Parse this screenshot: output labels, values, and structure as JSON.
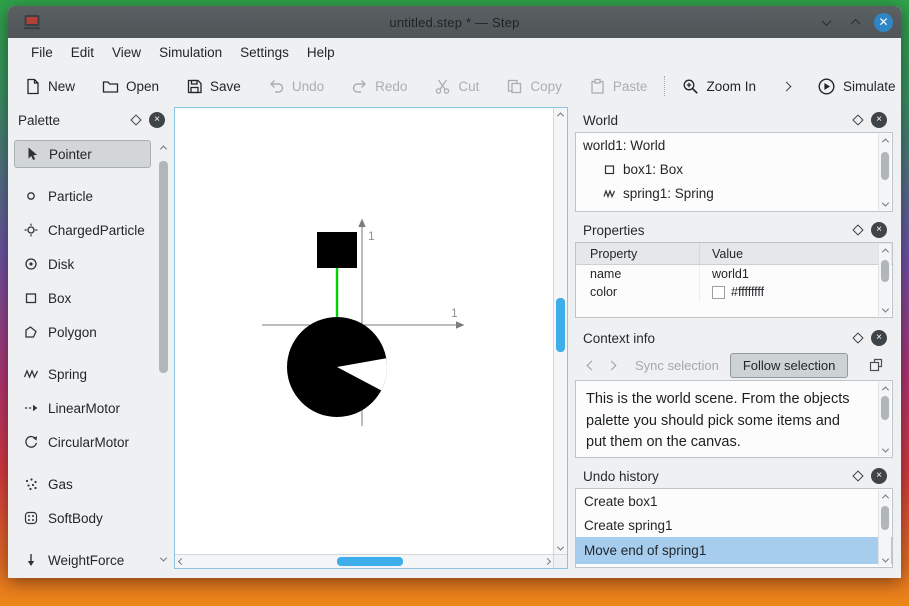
{
  "window": {
    "title": "untitled.step * — Step"
  },
  "menubar": {
    "items": [
      "File",
      "Edit",
      "View",
      "Simulation",
      "Settings",
      "Help"
    ]
  },
  "toolbar": {
    "new": "New",
    "open": "Open",
    "save": "Save",
    "undo": "Undo",
    "redo": "Redo",
    "cut": "Cut",
    "copy": "Copy",
    "paste": "Paste",
    "zoom_in": "Zoom In",
    "simulate": "Simulate"
  },
  "palette": {
    "title": "Palette",
    "items": [
      {
        "label": "Pointer",
        "icon": "pointer-icon",
        "selected": true
      },
      {
        "label": "Particle",
        "icon": "particle-icon",
        "selected": false
      },
      {
        "label": "ChargedParticle",
        "icon": "charged-particle-icon",
        "selected": false
      },
      {
        "label": "Disk",
        "icon": "disk-icon",
        "selected": false
      },
      {
        "label": "Box",
        "icon": "box-icon",
        "selected": false
      },
      {
        "label": "Polygon",
        "icon": "polygon-icon",
        "selected": false
      },
      {
        "label": "Spring",
        "icon": "spring-icon",
        "selected": false
      },
      {
        "label": "LinearMotor",
        "icon": "linear-motor-icon",
        "selected": false
      },
      {
        "label": "CircularMotor",
        "icon": "circular-motor-icon",
        "selected": false
      },
      {
        "label": "Gas",
        "icon": "gas-icon",
        "selected": false
      },
      {
        "label": "SoftBody",
        "icon": "soft-body-icon",
        "selected": false
      },
      {
        "label": "WeightForce",
        "icon": "weight-force-icon",
        "selected": false
      }
    ]
  },
  "canvas": {
    "x_axis_label": "1",
    "y_axis_label": "1"
  },
  "world_panel": {
    "title": "World",
    "items": [
      {
        "label": "world1: World",
        "indent": 0
      },
      {
        "label": "box1: Box",
        "indent": 1,
        "icon": "box-icon"
      },
      {
        "label": "spring1: Spring",
        "indent": 1,
        "icon": "spring-icon"
      }
    ]
  },
  "properties_panel": {
    "title": "Properties",
    "columns": [
      "Property",
      "Value"
    ],
    "rows": [
      {
        "property": "name",
        "value": "world1"
      },
      {
        "property": "color",
        "value": "#ffffffff",
        "swatch": "#ffffff"
      }
    ]
  },
  "context_panel": {
    "title": "Context info",
    "sync_label": "Sync selection",
    "follow_label": "Follow selection",
    "body": "This is the world scene. From the objects palette you should pick some items and put them on the canvas."
  },
  "undo_panel": {
    "title": "Undo history",
    "items": [
      {
        "label": "Create box1",
        "selected": false
      },
      {
        "label": "Create spring1",
        "selected": false
      },
      {
        "label": "Move end of spring1",
        "selected": true
      }
    ]
  },
  "colors": {
    "accent": "#3daee9",
    "selection_blue": "#a6cdee",
    "spring_green": "#00d400",
    "titlebar_close": "#2e86c8"
  }
}
